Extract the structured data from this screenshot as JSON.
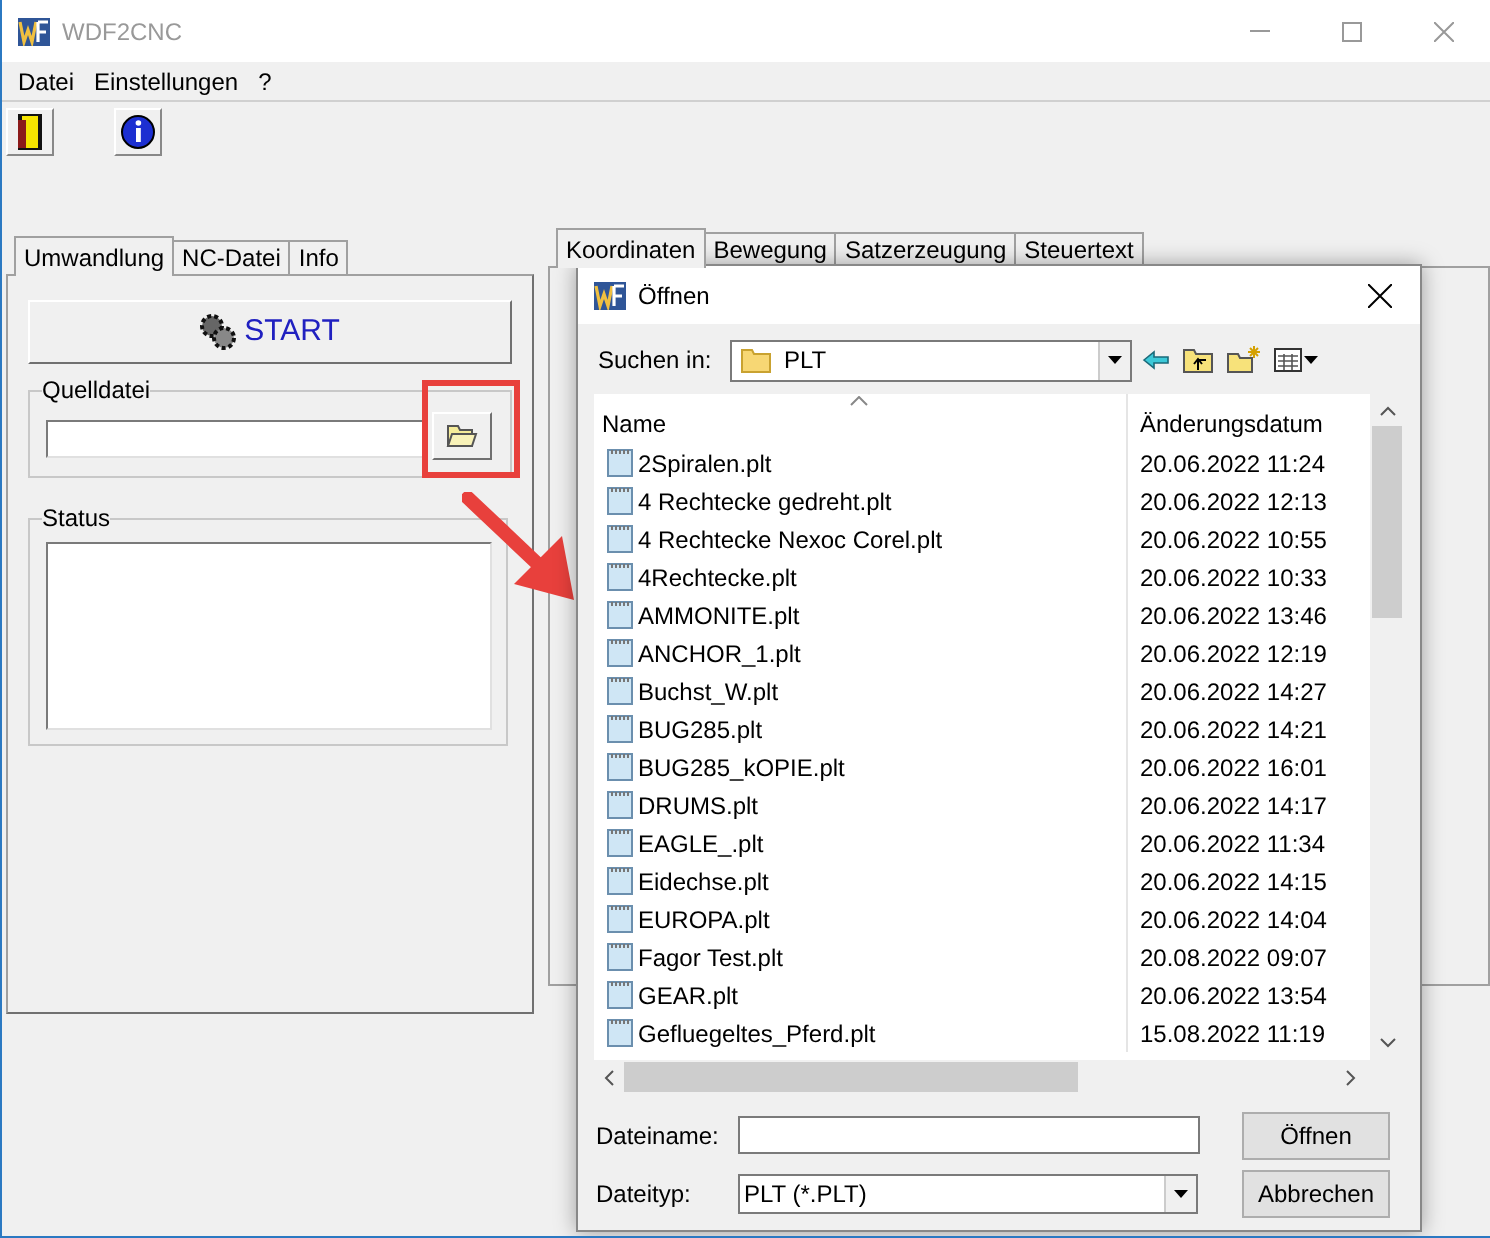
{
  "window": {
    "title": "WDF2CNC"
  },
  "menu": [
    "Datei",
    "Einstellungen",
    "?"
  ],
  "left_tabs": [
    {
      "label": "Umwandlung",
      "selected": true
    },
    {
      "label": "NC-Datei",
      "selected": false
    },
    {
      "label": "Info",
      "selected": false
    }
  ],
  "start_button": "START",
  "source_group": {
    "title": "Quelldatei"
  },
  "status_group": {
    "title": "Status"
  },
  "right_tabs": [
    {
      "label": "Koordinaten",
      "selected": true
    },
    {
      "label": "Bewegung",
      "selected": false
    },
    {
      "label": "Satzerzeugung",
      "selected": false
    },
    {
      "label": "Steuertext",
      "selected": false
    }
  ],
  "dialog": {
    "title": "Öffnen",
    "look_in_label": "Suchen in:",
    "look_in": "PLT",
    "columns": [
      "Name",
      "Änderungsdatum"
    ],
    "files": [
      {
        "name": "2Spiralen.plt",
        "date": "20.06.2022 11:24"
      },
      {
        "name": "4 Rechtecke gedreht.plt",
        "date": "20.06.2022 12:13"
      },
      {
        "name": "4 Rechtecke Nexoc Corel.plt",
        "date": "20.06.2022 10:55"
      },
      {
        "name": "4Rechtecke.plt",
        "date": "20.06.2022 10:33"
      },
      {
        "name": "AMMONITE.plt",
        "date": "20.06.2022 13:46"
      },
      {
        "name": "ANCHOR_1.plt",
        "date": "20.06.2022 12:19"
      },
      {
        "name": "Buchst_W.plt",
        "date": "20.06.2022 14:27"
      },
      {
        "name": "BUG285.plt",
        "date": "20.06.2022 14:21"
      },
      {
        "name": "BUG285_kOPIE.plt",
        "date": "20.06.2022 16:01"
      },
      {
        "name": "DRUMS.plt",
        "date": "20.06.2022 14:17"
      },
      {
        "name": "EAGLE_.plt",
        "date": "20.06.2022 11:34"
      },
      {
        "name": "Eidechse.plt",
        "date": "20.06.2022 14:15"
      },
      {
        "name": "EUROPA.plt",
        "date": "20.06.2022 14:04"
      },
      {
        "name": "Fagor Test.plt",
        "date": "20.08.2022 09:07"
      },
      {
        "name": "GEAR.plt",
        "date": "20.06.2022 13:54"
      },
      {
        "name": "Gefluegeltes_Pferd.plt",
        "date": "15.08.2022 11:19"
      }
    ],
    "filename_label": "Dateiname:",
    "filetype_label": "Dateityp:",
    "filetype": "PLT (*.PLT)",
    "buttons": [
      "Öffnen",
      "Abbrechen"
    ]
  }
}
